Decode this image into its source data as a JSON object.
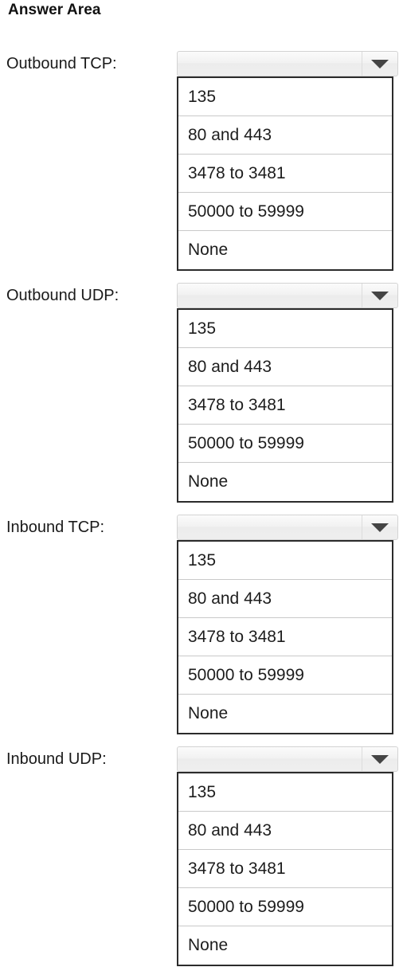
{
  "page": {
    "title": "Answer Area"
  },
  "dropdown": {
    "arrow_icon": "chevron-down-icon",
    "selected_value": "",
    "placeholder": ""
  },
  "groups": [
    {
      "label": "Outbound TCP:",
      "selected_value": "",
      "options": [
        "135",
        "80 and 443",
        "3478 to 3481",
        "50000 to 59999",
        "None"
      ]
    },
    {
      "label": "Outbound UDP:",
      "selected_value": "",
      "options": [
        "135",
        "80 and 443",
        "3478 to 3481",
        "50000 to 59999",
        "None"
      ]
    },
    {
      "label": "Inbound TCP:",
      "selected_value": "",
      "options": [
        "135",
        "80 and 443",
        "3478 to 3481",
        "50000 to 59999",
        "None"
      ]
    },
    {
      "label": "Inbound UDP:",
      "selected_value": "",
      "options": [
        "135",
        "80 and 443",
        "3478 to 3481",
        "50000 to 59999",
        "None"
      ]
    }
  ],
  "layout": {
    "group_tops": [
      62,
      353,
      644,
      935
    ]
  }
}
